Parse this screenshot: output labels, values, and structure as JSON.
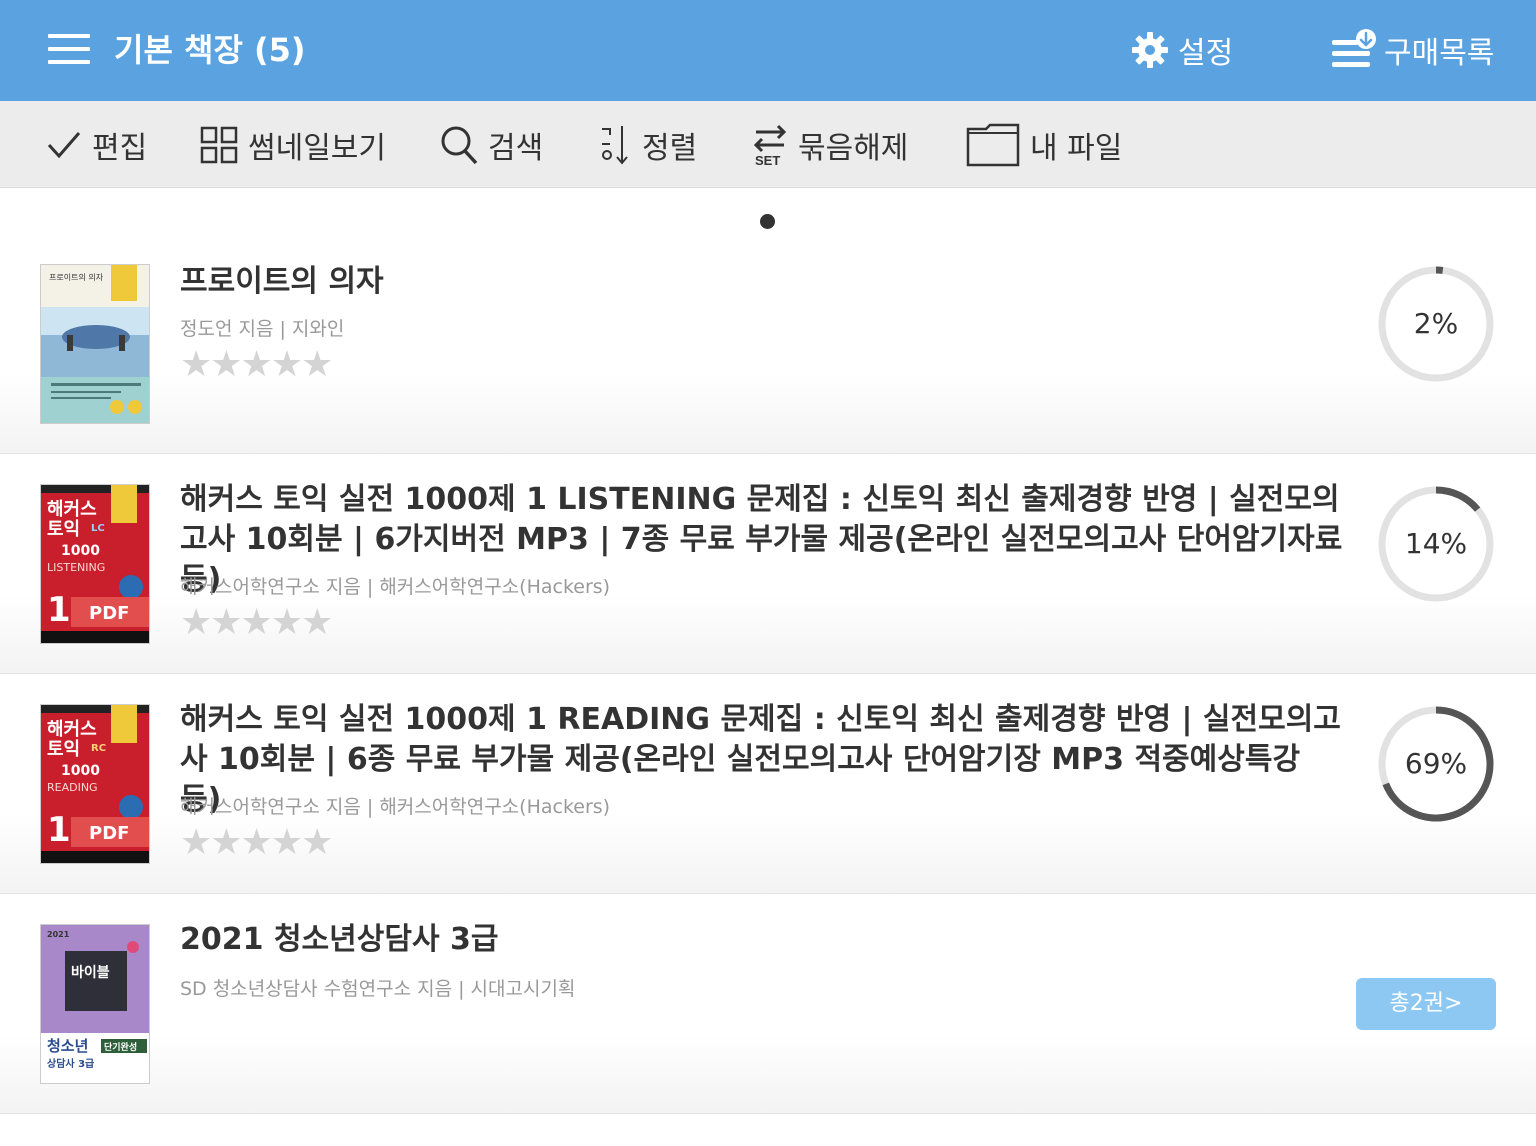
{
  "header": {
    "title": "기본 책장 (5)",
    "settings_label": "설정",
    "purchases_label": "구매목록",
    "bg_color": "#5aa3e0"
  },
  "toolbar": {
    "edit_label": "편집",
    "thumbnail_label": "썸네일보기",
    "search_label": "검색",
    "sort_label": "정렬",
    "ungroup_label": "묶음해제",
    "ungroup_sub": "SET",
    "myfiles_label": "내 파일"
  },
  "pager": {
    "current_page": 1,
    "total_pages": 1
  },
  "books": [
    {
      "title": "프로이트의 의자",
      "meta": "정도언 지음 | 지와인",
      "stars": "★★★★★",
      "rating": 0,
      "progress": 2,
      "progress_label": "2%",
      "cover_title": "프로이트의 의자"
    },
    {
      "title": "해커스 토익 실전 1000제 1 LISTENING 문제집 : 신토익 최신 출제경향 반영 | 실전모의고사 10회분 | 6가지버전 MP3 | 7종 무료 부가물 제공(온라인 실전모의고사 단어암기자료 등)",
      "meta": "해커스어학연구소 지음 | 해커스어학연구소(Hackers)",
      "stars": "★★★★★",
      "rating": 0,
      "progress": 14,
      "progress_label": "14%",
      "cover_brand": "해커스",
      "cover_sub": "토익",
      "cover_tag": "LC",
      "cover_count": "1000",
      "cover_series": "LISTENING",
      "cover_num": "1",
      "cover_pdf": "PDF"
    },
    {
      "title": "해커스 토익 실전 1000제 1 READING 문제집 : 신토익 최신 출제경향 반영 | 실전모의고사 10회분 | 6종 무료 부가물 제공(온라인 실전모의고사 단어암기장 MP3 적중예상특강 등)",
      "meta": "해커스어학연구소 지음 | 해커스어학연구소(Hackers)",
      "stars": "★★★★★",
      "rating": 0,
      "progress": 69,
      "progress_label": "69%",
      "cover_brand": "해커스",
      "cover_sub": "토익",
      "cover_tag": "RC",
      "cover_count": "1000",
      "cover_series": "READING",
      "cover_num": "1",
      "cover_pdf": "PDF"
    },
    {
      "title": "2021 청소년상담사 3급",
      "meta": "SD 청소년상담사 수험연구소 지음 | 시대고시기획",
      "series_label": "총2권>",
      "cover_year": "2021",
      "cover_big": "바이블",
      "cover_main": "청소년",
      "cover_sub": "상담사 3급",
      "cover_tag": "단기완성"
    }
  ]
}
